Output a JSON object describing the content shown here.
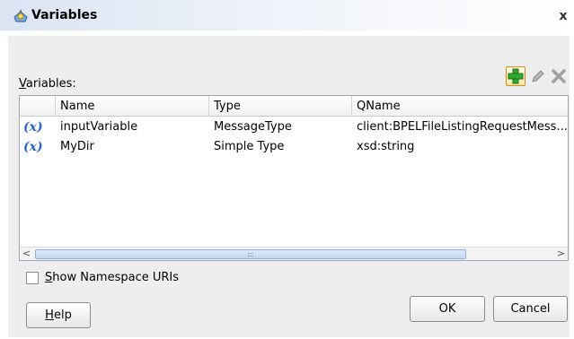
{
  "window": {
    "title": "Variables",
    "close_glyph": "x"
  },
  "main": {
    "variables_label_mnemonic": "V",
    "variables_label_rest": "ariables:"
  },
  "toolbar": {
    "icons": [
      "add-icon",
      "edit-pencil-icon",
      "delete-x-icon"
    ],
    "add_icon_color": "#2faa2f",
    "add_border_color": "#d98b12"
  },
  "table": {
    "columns": [
      "Name",
      "Type",
      "QName"
    ],
    "row_icon_text": "(x)",
    "rows": [
      {
        "name": "inputVariable",
        "type": "MessageType",
        "qname": "client:BPELFileListingRequestMess..."
      },
      {
        "name": "MyDir",
        "type": "Simple Type",
        "qname": "xsd:string"
      }
    ]
  },
  "scrollbar": {
    "left_glyph": "<",
    "right_glyph": ">"
  },
  "options": {
    "show_namespace_mnemonic": "S",
    "show_namespace_rest": "how Namespace URIs",
    "show_namespace_checked": false
  },
  "buttons": {
    "help_mnemonic": "H",
    "help_rest": "elp",
    "ok": "OK",
    "cancel": "Cancel"
  }
}
